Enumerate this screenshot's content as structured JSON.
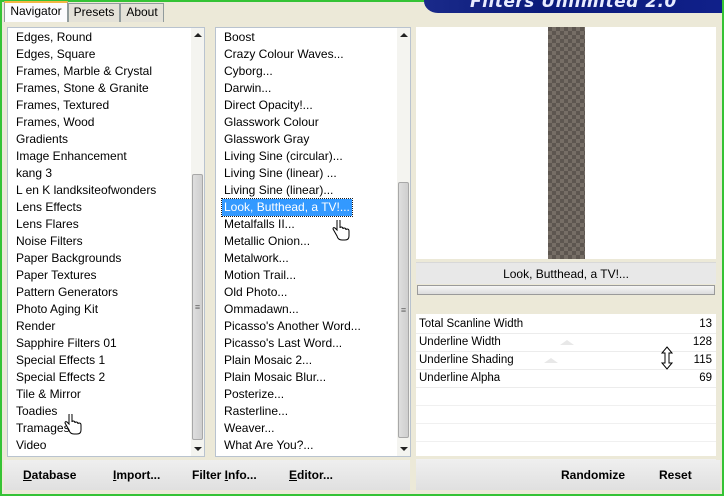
{
  "tabs": [
    {
      "label": "Navigator",
      "active": true
    },
    {
      "label": "Presets",
      "active": false
    },
    {
      "label": "About",
      "active": false
    }
  ],
  "banner": {
    "title": "Filters Unlimited 2.0"
  },
  "categories": {
    "items": [
      "Edges, Round",
      "Edges, Square",
      "Frames, Marble & Crystal",
      "Frames, Stone & Granite",
      "Frames, Textured",
      "Frames, Wood",
      "Gradients",
      "Image Enhancement",
      "kang 3",
      "L en K landksiteofwonders",
      "Lens Effects",
      "Lens Flares",
      "Noise Filters",
      "Paper Backgrounds",
      "Paper Textures",
      "Pattern Generators",
      "Photo Aging Kit",
      "Render",
      "Sapphire Filters 01",
      "Special Effects 1",
      "Special Effects 2",
      "Tile & Mirror",
      "Toadies",
      "Tramages",
      "Video"
    ],
    "scroll_thumb": "≡"
  },
  "filters": {
    "items": [
      "Boost",
      "Crazy Colour Waves...",
      "Cyborg...",
      "Darwin...",
      "Direct Opacity!...",
      "Glasswork Colour",
      "Glasswork Gray",
      "Living Sine (circular)...",
      "Living Sine (linear) ...",
      "Living Sine (linear)...",
      "Look, Butthead, a TV!...",
      "Metalfalls II...",
      "Metallic Onion...",
      "Metalwork...",
      "Motion Trail...",
      "Old Photo...",
      "Ommadawn...",
      "Picasso's Another Word...",
      "Picasso's Last Word...",
      "Plain Mosaic 2...",
      "Plain Mosaic Blur...",
      "Posterize...",
      "Rasterline...",
      "Weaver...",
      "What Are You?..."
    ],
    "selected_index": 10,
    "scroll_thumb": "≡"
  },
  "preview": {
    "filter_name": "Look, Butthead, a TV!...",
    "image_colors": {
      "base": "#5d5650",
      "check": "#766e66"
    }
  },
  "parameters": [
    {
      "label": "Total Scanline Width",
      "value": "13"
    },
    {
      "label": "Underline Width",
      "value": "128"
    },
    {
      "label": "Underline Shading",
      "value": "115"
    },
    {
      "label": "Underline Alpha",
      "value": "69"
    }
  ],
  "bottom_buttons": {
    "database": {
      "u": "D",
      "rest": "atabase"
    },
    "import": {
      "u": "I",
      "rest": "mport..."
    },
    "filter_info": {
      "pre": "Filter ",
      "u": "I",
      "rest": "nfo..."
    },
    "editor": {
      "u": "E",
      "rest": "ditor..."
    },
    "randomize": "Randomize",
    "reset": "Reset"
  },
  "colors": {
    "selection": "#3399ff",
    "frame": "#35c335",
    "banner": "#0a1a7a"
  }
}
